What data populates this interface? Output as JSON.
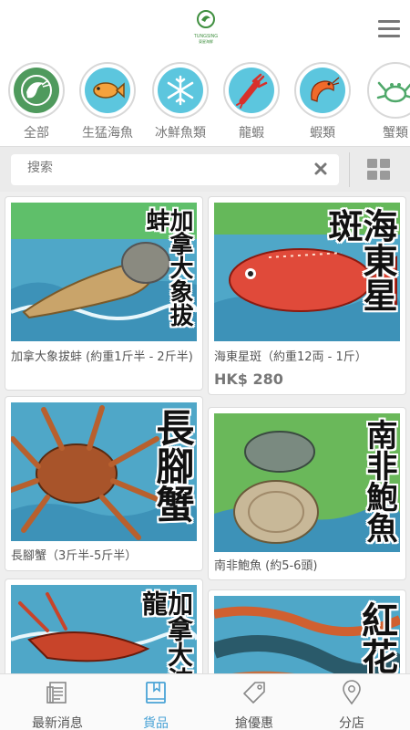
{
  "header": {
    "logo_text": "TUNGSING",
    "logo_subtext": "東星海鮮"
  },
  "categories": [
    {
      "label": "全部",
      "icon": "shrimp-green-icon"
    },
    {
      "label": "生猛海魚",
      "icon": "fish-icon"
    },
    {
      "label": "冰鮮魚類",
      "icon": "snowflake-icon"
    },
    {
      "label": "龍蝦",
      "icon": "lobster-icon"
    },
    {
      "label": "蝦類",
      "icon": "shrimp-icon"
    },
    {
      "label": "蟹類",
      "icon": "crab-icon"
    }
  ],
  "search": {
    "placeholder": "搜索"
  },
  "products": [
    {
      "title": "加拿大象拔蚌 (約重1斤半 - 2斤半)",
      "image_text": "加拿大象拔蚌",
      "price": ""
    },
    {
      "title": "海東星斑（約重12両 - 1斤）",
      "image_text": "海東星斑",
      "price": "HK$ 280"
    },
    {
      "title": "長腳蟹（3斤半-5斤半）",
      "image_text": "長腳蟹",
      "price": ""
    },
    {
      "title": "南非鮑魚 (約5-6頭)",
      "image_text": "南非鮑魚",
      "price": ""
    },
    {
      "title": "",
      "image_text": "加拿大波龍",
      "price": ""
    },
    {
      "title": "",
      "image_text": "紅花",
      "price": ""
    }
  ],
  "tabs": [
    {
      "label": "最新消息",
      "icon": "news-icon",
      "active": false
    },
    {
      "label": "貨品",
      "icon": "book-icon",
      "active": true
    },
    {
      "label": "搶優惠",
      "icon": "tag-icon",
      "active": false
    },
    {
      "label": "分店",
      "icon": "location-pin-icon",
      "active": false
    }
  ],
  "colors": {
    "accent": "#4aa3d6",
    "category_circle": "#5cc6de",
    "icon_green": "#3f8f3f"
  }
}
